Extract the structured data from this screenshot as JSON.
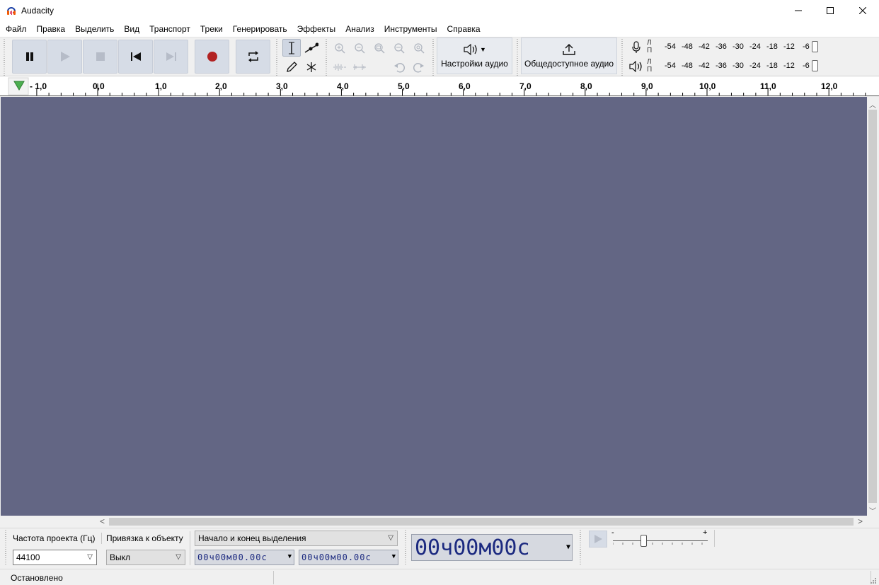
{
  "window": {
    "title": "Audacity",
    "minimize_icon": "minimize-icon",
    "maximize_icon": "maximize-icon",
    "close_icon": "close-icon"
  },
  "menu": {
    "items": [
      "Файл",
      "Правка",
      "Выделить",
      "Вид",
      "Транспорт",
      "Треки",
      "Генерировать",
      "Эффекты",
      "Анализ",
      "Инструменты",
      "Справка"
    ]
  },
  "toolbar": {
    "transport": {
      "pause_icon": "pause-icon",
      "play_icon": "play-icon",
      "stop_icon": "stop-icon",
      "skip_start_icon": "skip-to-start-icon",
      "skip_end_icon": "skip-to-end-icon",
      "record_icon": "record-icon",
      "loop_icon": "loop-icon"
    },
    "audio_setup_label": "Настройки аудио",
    "share_audio_label": "Общедоступное аудио",
    "meters": {
      "record_channels": [
        "Л",
        "П"
      ],
      "playback_channels": [
        "Л",
        "П"
      ],
      "scale": [
        "-54",
        "-48",
        "-42",
        "-36",
        "-30",
        "-24",
        "-18",
        "-12",
        "-6"
      ]
    }
  },
  "ruler": {
    "labels": [
      "- 1,0",
      "0,0",
      "1,0",
      "2,0",
      "3,0",
      "4,0",
      "5,0",
      "6,0",
      "7,0",
      "8,0",
      "9,0",
      "10,0",
      "11,0",
      "12,0"
    ]
  },
  "selection_toolbar": {
    "project_rate_label": "Частота проекта (Гц)",
    "snap_label": "Привязка к объекту",
    "project_rate_value": "44100",
    "snap_value": "Выкл",
    "selection_mode": "Начало и конец выделения",
    "start_time": {
      "h": "00",
      "h_unit": "ч",
      "m": "00",
      "m_unit": "м",
      "s": "00.00",
      "s_unit": "с"
    },
    "end_time": {
      "h": "00",
      "h_unit": "ч",
      "m": "00",
      "m_unit": "м",
      "s": "00.00",
      "s_unit": "с"
    },
    "audio_position": {
      "h": "00",
      "h_unit": "ч",
      "m": "00",
      "m_unit": "м",
      "s": "00",
      "s_unit": "с"
    },
    "speed_min": "-",
    "speed_max": "+"
  },
  "status": {
    "text": "Остановлено"
  },
  "colors": {
    "track_bg": "#636684",
    "button_bg": "#d6dce6",
    "record_red": "#b22222",
    "time_text": "#1c2a80"
  }
}
